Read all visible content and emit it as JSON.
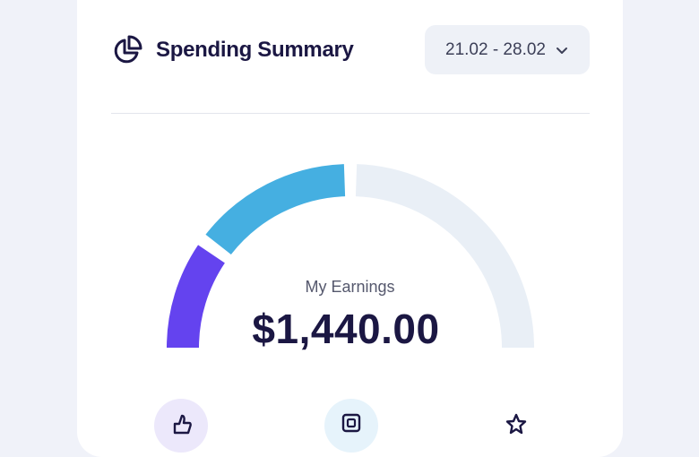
{
  "header": {
    "title": "Spending Summary",
    "icon": "pie-chart-icon",
    "date_range": "21.02 - 28.02"
  },
  "gauge": {
    "label": "My Earnings",
    "amount": "$1,440.00",
    "segments": [
      {
        "name": "purple-segment",
        "color": "#6443ef",
        "fraction": 0.2
      },
      {
        "name": "blue-segment",
        "color": "#45afe1",
        "fraction": 0.3
      },
      {
        "name": "gray-segment",
        "color": "#e9eff6",
        "fraction": 0.5
      }
    ]
  },
  "categories": [
    {
      "icon": "thumb-icon",
      "bg": "#ece8fb"
    },
    {
      "icon": "grid-icon",
      "bg": "#e6f3fb"
    },
    {
      "icon": "star-icon",
      "bg": "#ffffff"
    }
  ],
  "colors": {
    "background": "#f0f2f9",
    "card": "#ffffff",
    "text_dark": "#1b1743",
    "accent_purple": "#6443ef",
    "accent_blue": "#45afe1"
  }
}
